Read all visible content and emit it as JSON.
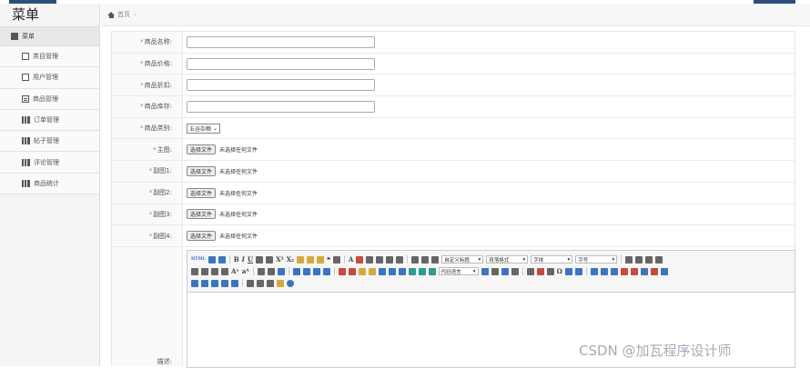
{
  "sidebar": {
    "title": "菜单",
    "section": "菜单",
    "items": [
      {
        "label": "类目管理",
        "icon": "document-icon"
      },
      {
        "label": "用户管理",
        "icon": "document-icon"
      },
      {
        "label": "商品管理",
        "icon": "list-icon"
      },
      {
        "label": "订单管理",
        "icon": "bar-chart-icon"
      },
      {
        "label": "帖子管理",
        "icon": "bar-chart-icon"
      },
      {
        "label": "评论管理",
        "icon": "bar-chart-icon"
      },
      {
        "label": "商品统计",
        "icon": "bar-chart-icon"
      }
    ]
  },
  "breadcrumb": {
    "home": "首页",
    "separator": "›"
  },
  "form": {
    "name_label": "商品名称:",
    "price_label": "商品价格:",
    "discount_label": "商品折扣:",
    "stock_label": "商品库存:",
    "category_label": "商品类别:",
    "category_value": "五谷杂粮",
    "main_img_label": "主图:",
    "sub1_label": "副图1:",
    "sub2_label": "副图2:",
    "sub3_label": "副图3:",
    "sub4_label": "副图4:",
    "desc_label": "描述:",
    "file_button": "选择文件",
    "file_none": "未选择任何文件",
    "required_mark": "*"
  },
  "editor": {
    "title_combo": "自定义标题",
    "paragraph_combo": "段落格式",
    "font_combo": "字体",
    "size_combo": "字号",
    "code_combo": "代码语言",
    "html_label": "HTML"
  },
  "watermark": "CSDN @加瓦程序设计师",
  "colors": {
    "accent": "#2b4f7a",
    "required": "#e0703a"
  }
}
